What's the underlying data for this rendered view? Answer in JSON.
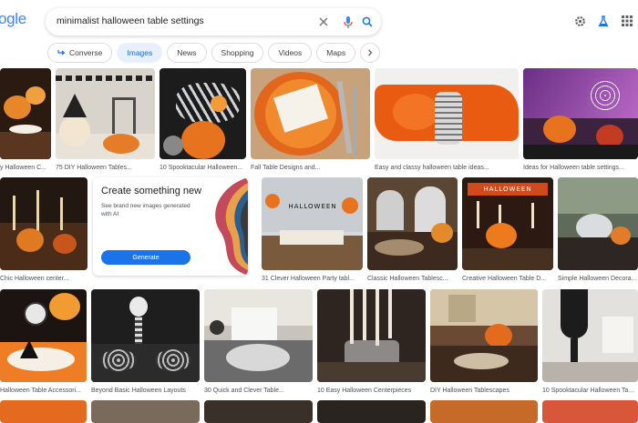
{
  "header": {
    "logo_text": "ogle",
    "query": "minimalist halloween table settings"
  },
  "chips": [
    {
      "label": "Converse",
      "active": false
    },
    {
      "label": "Images",
      "active": true
    },
    {
      "label": "News",
      "active": false
    },
    {
      "label": "Shopping",
      "active": false
    },
    {
      "label": "Videos",
      "active": false
    },
    {
      "label": "Maps",
      "active": false
    }
  ],
  "create_card": {
    "title": "Create something new",
    "description": "See brand new images generated with AI",
    "button_label": "Generate"
  },
  "results": {
    "row1": [
      "y Halloween C...",
      "75 DIY Halloween Tables...",
      "10 Spooktacular Halloween...",
      "Fall Table Designs and...",
      "Easy and classy halloween table ideas...",
      "Ideas for Halloween table settings..."
    ],
    "row2": [
      "Chic Halloween center...",
      "31 Clever Halloween Party tabl...",
      "Classic Halloween Tablesc...",
      "Creative Halloween Table D...",
      "Simple Halloween Decorati..."
    ],
    "row3": [
      "Halloween Table Accessori...",
      "Beyond Basic Halloween Layouts",
      "30 Quick and Clever Table...",
      "10 Easy Halloween Centerpieces",
      "DIY Halloween Tablescapes",
      "10 Spooktacular Halloween Tabl..."
    ],
    "image_text": {
      "halloween_banner": "HALLOWEEN",
      "garland": "HALLOWEEN"
    }
  },
  "colors": {
    "accent_blue": "#1a73e8",
    "chip_active_bg": "#e8f0fe",
    "halloween_orange": "#e8641e"
  }
}
